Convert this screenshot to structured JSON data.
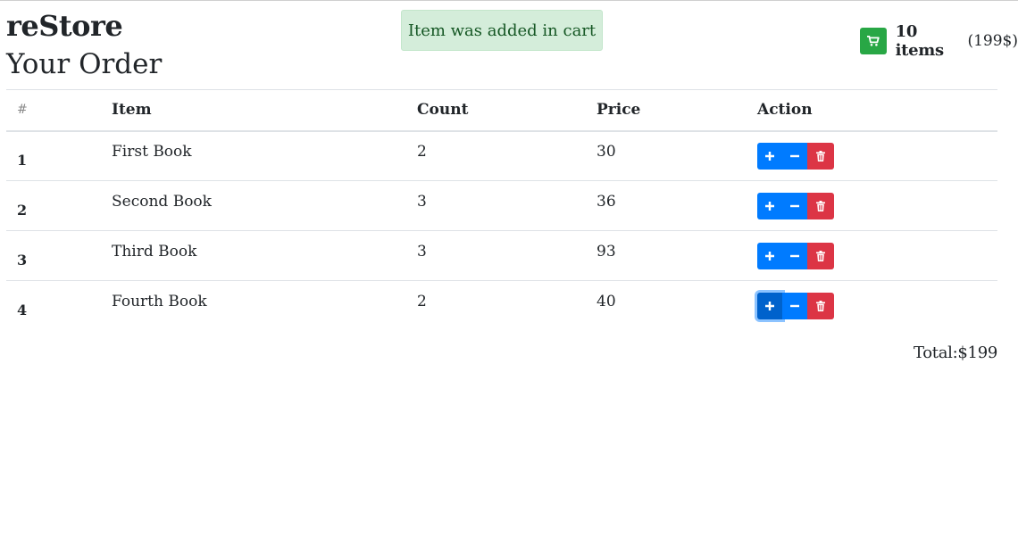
{
  "header": {
    "brand": "reStore",
    "cart_count_label": "10 items",
    "cart_total_label": "(199$)",
    "cart_icon": "shopping-cart-icon"
  },
  "notification": {
    "text": "Item was added in cart",
    "color": "#d4edda"
  },
  "page_title": "Your Order",
  "table": {
    "columns": [
      "#",
      "Item",
      "Count",
      "Price",
      "Action"
    ],
    "rows": [
      {
        "num": "1",
        "item": "First Book",
        "count": "2",
        "price": "30"
      },
      {
        "num": "2",
        "item": "Second Book",
        "count": "3",
        "price": "36"
      },
      {
        "num": "3",
        "item": "Third Book",
        "count": "3",
        "price": "93"
      },
      {
        "num": "4",
        "item": "Fourth Book",
        "count": "2",
        "price": "40"
      }
    ],
    "action_icons": [
      "plus-icon",
      "minus-icon",
      "trash-icon"
    ]
  },
  "total_label": "Total:$199",
  "colors": {
    "primary": "#007bff",
    "danger": "#dc3545",
    "success": "#28a745"
  }
}
